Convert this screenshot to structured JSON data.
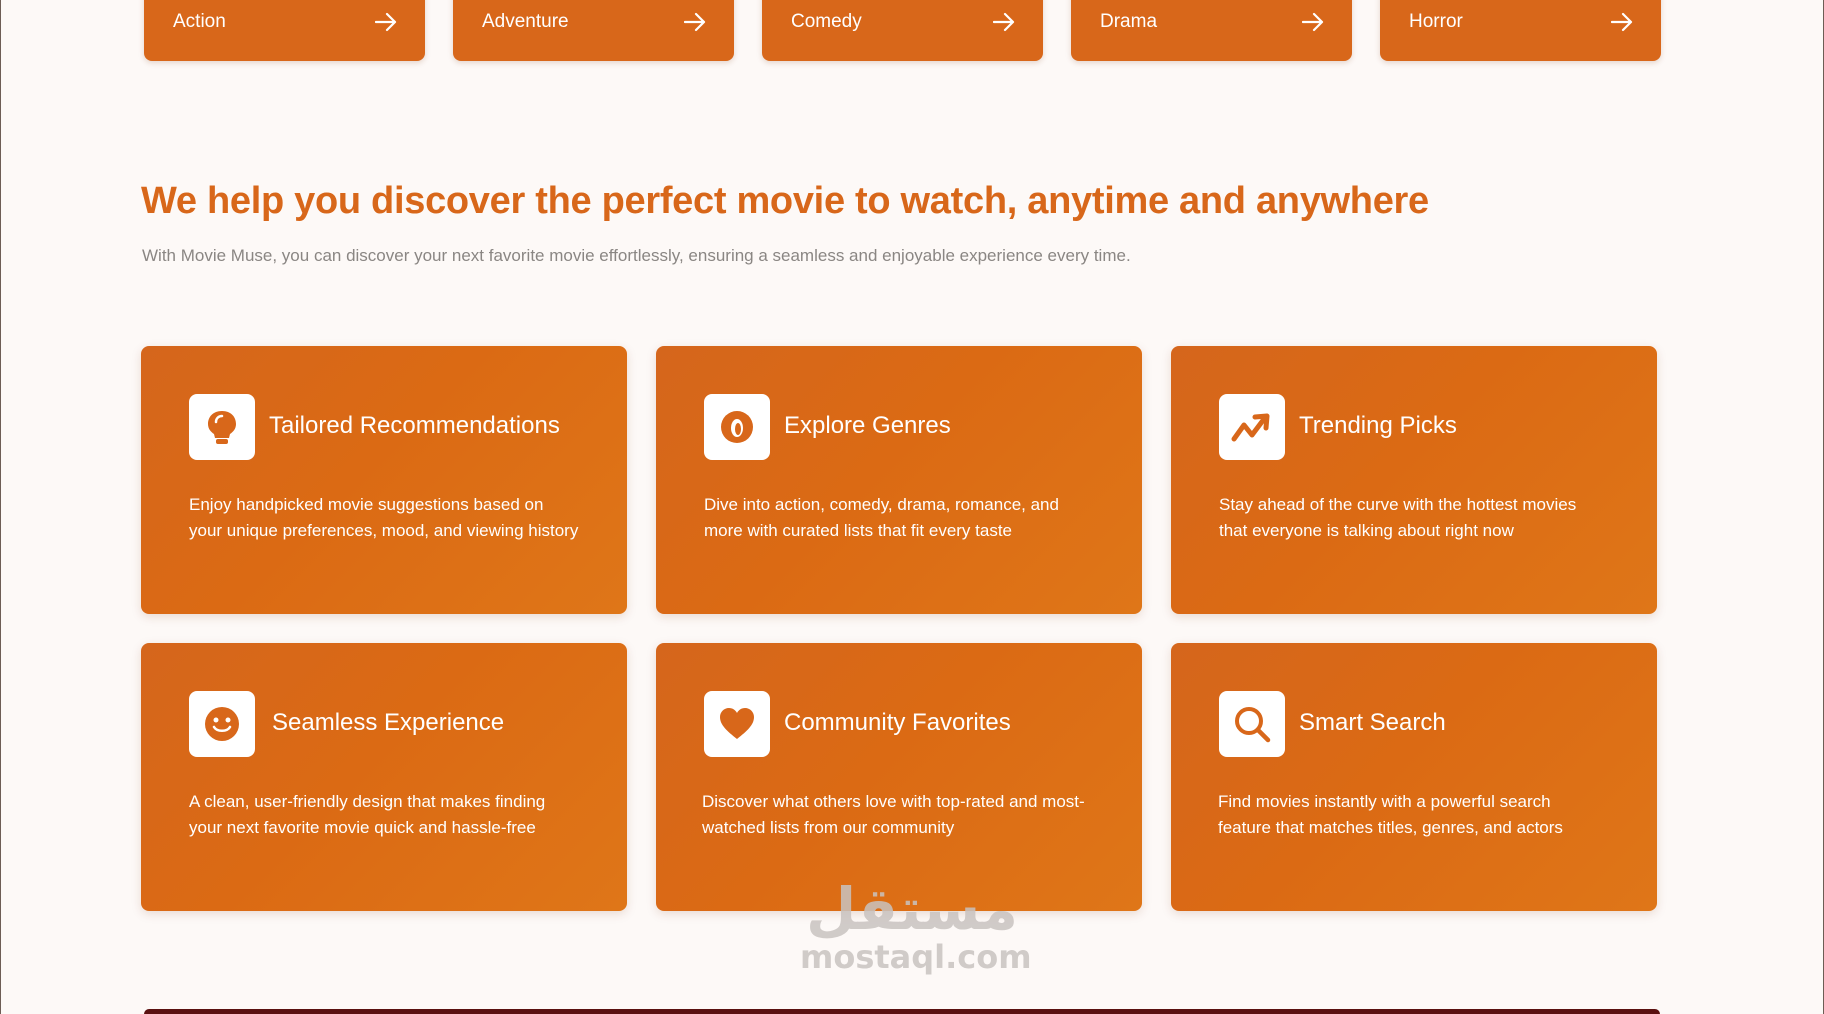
{
  "genres": [
    {
      "label": "Action"
    },
    {
      "label": "Adventure"
    },
    {
      "label": "Comedy"
    },
    {
      "label": "Drama"
    },
    {
      "label": "Horror"
    }
  ],
  "section": {
    "title": "We help you discover the perfect movie to watch, anytime and anywhere",
    "subtitle": "With Movie Muse, you can discover your next favorite movie effortlessly, ensuring a seamless and enjoyable experience every time."
  },
  "features": [
    {
      "icon": "lightbulb-icon",
      "title": "Tailored Recommendations",
      "description": "Enjoy handpicked movie suggestions based on your unique preferences, mood, and viewing history"
    },
    {
      "icon": "compass-icon",
      "title": "Explore Genres",
      "description": "Dive into action, comedy, drama, romance, and more with curated lists that fit every taste"
    },
    {
      "icon": "trending-icon",
      "title": "Trending Picks",
      "description": "Stay ahead of the curve with the hottest movies that everyone is talking about right now"
    },
    {
      "icon": "smiley-icon",
      "title": "Seamless Experience",
      "description": "A clean, user-friendly design that makes finding your next favorite movie quick and hassle-free"
    },
    {
      "icon": "heart-icon",
      "title": "Community Favorites",
      "description": "Discover what others love with top-rated and most-watched lists from our community"
    },
    {
      "icon": "search-icon",
      "title": "Smart Search",
      "description": "Find movies instantly with a powerful search feature that matches titles, genres, and actors"
    }
  ],
  "watermark": {
    "arabic": "مستقل",
    "latin": "mostaql.com"
  },
  "colors": {
    "accent": "#d8671a",
    "background": "#fdf9f7",
    "muted_text": "#8a8683"
  }
}
